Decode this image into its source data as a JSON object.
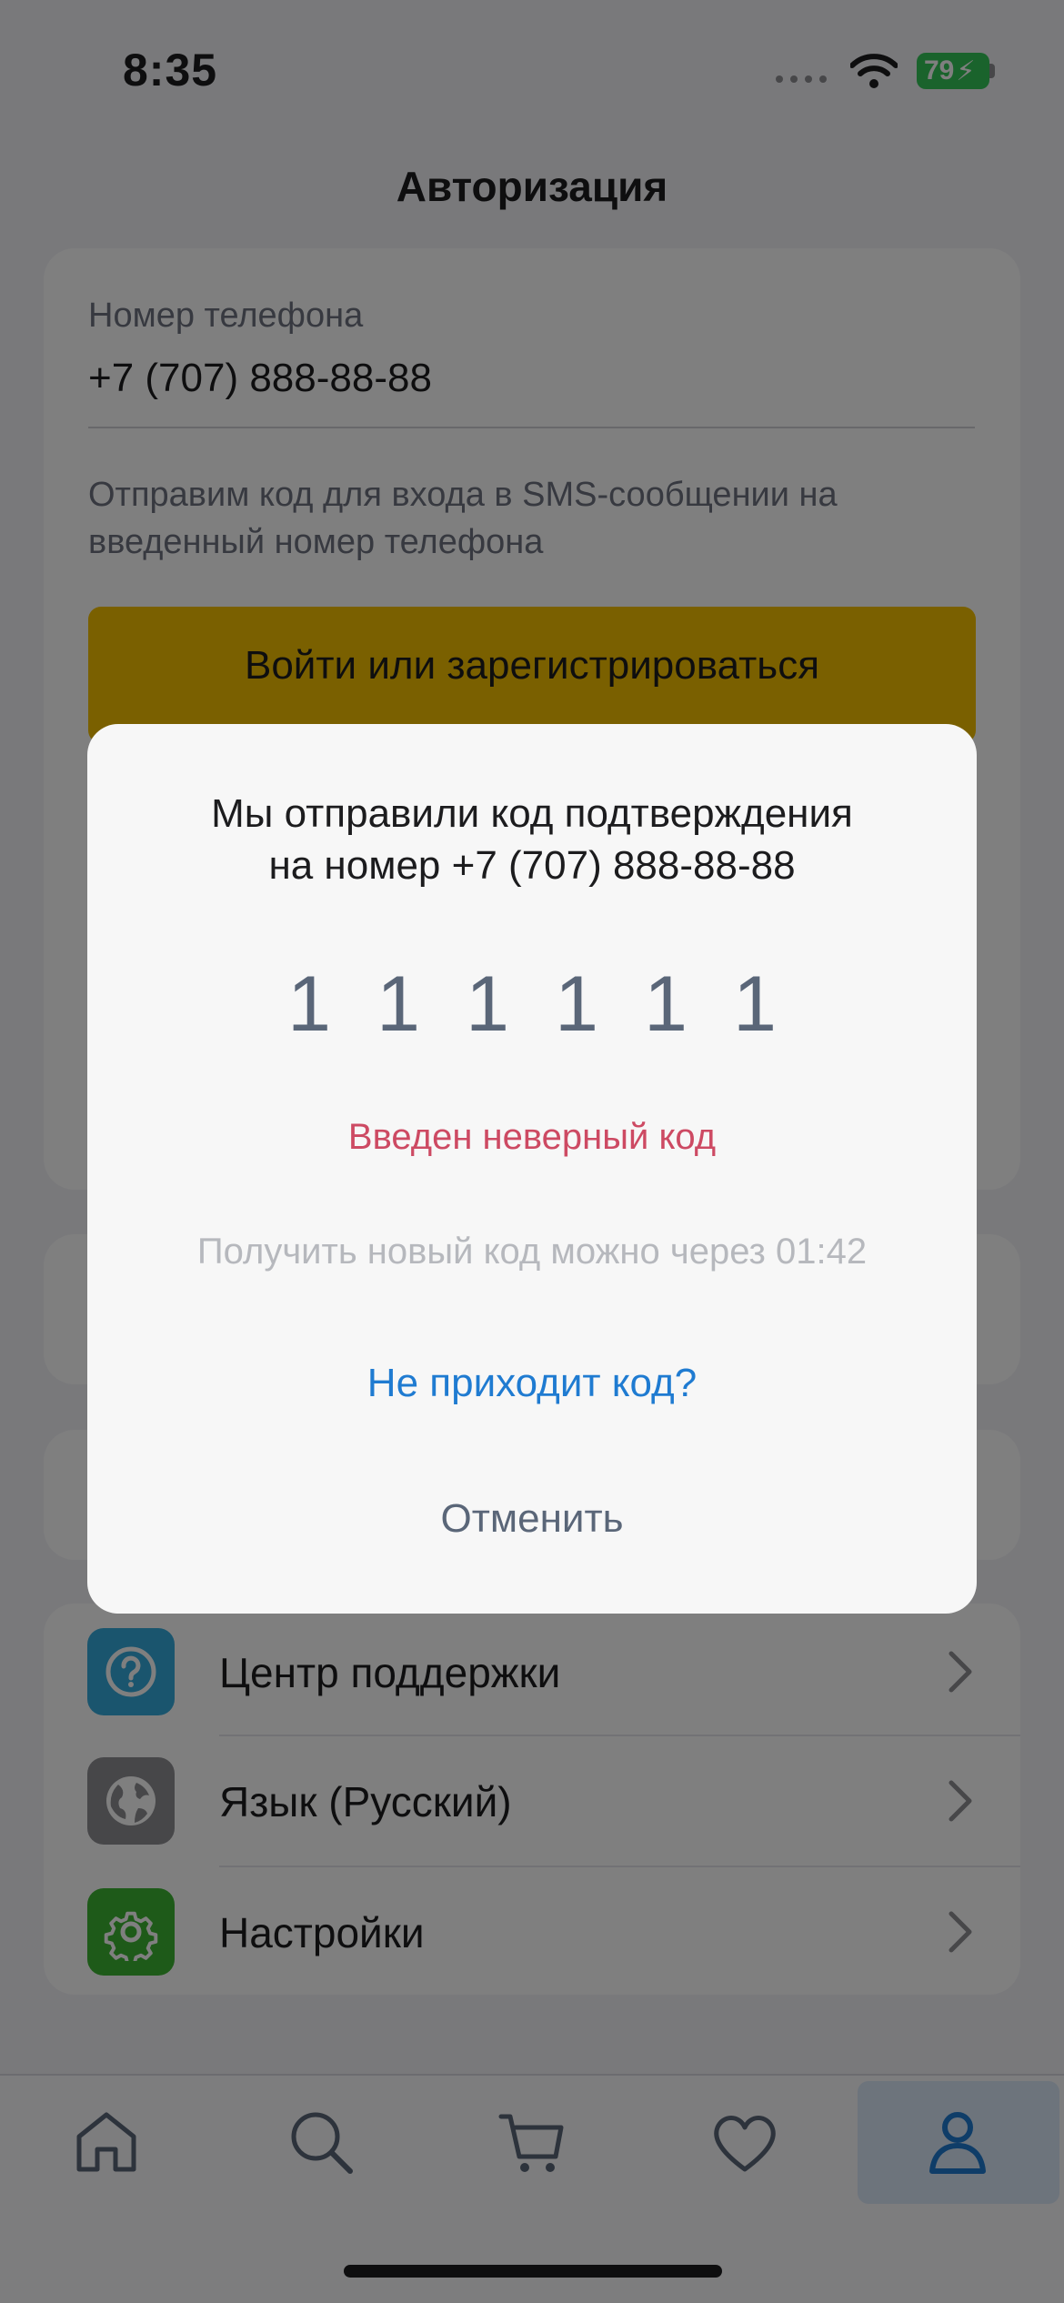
{
  "status_bar": {
    "time": "8:35",
    "battery": "79"
  },
  "header": {
    "title": "Авторизация"
  },
  "auth_form": {
    "phone_label": "Номер телефона",
    "phone_value": "+7 (707) 888-88-88",
    "hint": "Отправим код для входа в SMS-сообщении на введенный номер телефона",
    "submit_label": "Войти или зарегистрироваться"
  },
  "menu": {
    "items": [
      {
        "label": "Центр поддержки",
        "icon": "help-icon",
        "color": "#34aadc"
      },
      {
        "label": "Язык (Русский)",
        "icon": "globe-icon",
        "color": "#8e8e93"
      },
      {
        "label": "Настройки",
        "icon": "gear-icon",
        "color": "#3cb533"
      }
    ]
  },
  "tabbar": {
    "tabs": [
      "home-icon",
      "search-icon",
      "cart-icon",
      "heart-icon",
      "profile-icon"
    ],
    "active": "profile-icon"
  },
  "modal": {
    "title_line1": "Мы отправили код подтверждения",
    "title_line2": "на номер +7 (707) 888-88-88",
    "code": [
      "1",
      "1",
      "1",
      "1",
      "1",
      "1"
    ],
    "error": "Введен неверный код",
    "timer": "Получить новый код можно через 01:42",
    "no_code_link": "Не приходит код?",
    "cancel": "Отменить"
  },
  "colors": {
    "accent": "#1f7bd1",
    "primary_button": "#f5c000",
    "error": "#cd4a63"
  }
}
